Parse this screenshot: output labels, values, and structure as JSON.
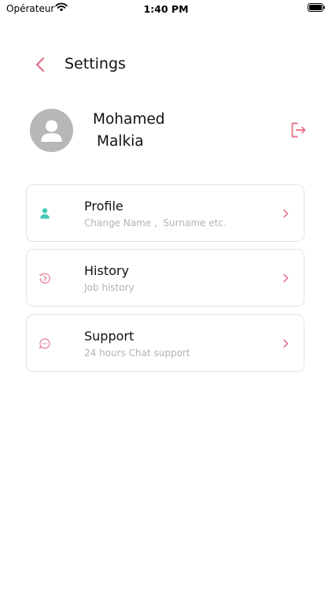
{
  "status_bar": {
    "carrier": "Opérateur",
    "time": "1:40 PM"
  },
  "header": {
    "title": "Settings",
    "back_icon": "chevron-left-icon"
  },
  "user": {
    "first_name": "Mohamed",
    "last_name": "Malkia",
    "avatar_icon": "person-icon",
    "logout_icon": "logout-icon"
  },
  "menu": [
    {
      "title": "Profile",
      "subtitle": "Change Name ,  Surname etc.",
      "icon": "user-icon",
      "icon_color": "#45c9b8"
    },
    {
      "title": "History",
      "subtitle": "Job history",
      "icon": "history-icon",
      "icon_color": "#e98da3"
    },
    {
      "title": "Support",
      "subtitle": "24 hours Chat support",
      "icon": "chat-icon",
      "icon_color": "#e98da3"
    }
  ],
  "colors": {
    "accent": "#e7798f",
    "teal": "#45c9b8",
    "avatar_bg": "#b7b7b7",
    "card_border": "#e3e3e3",
    "subtitle_gray": "#b3b3b3"
  }
}
